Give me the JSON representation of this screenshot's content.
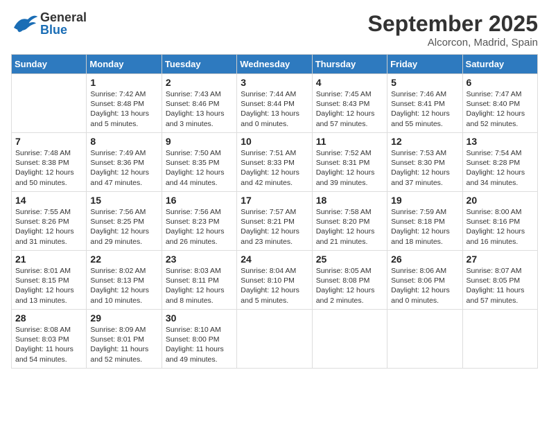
{
  "header": {
    "logo_general": "General",
    "logo_blue": "Blue",
    "month": "September 2025",
    "location": "Alcorcon, Madrid, Spain"
  },
  "days_of_week": [
    "Sunday",
    "Monday",
    "Tuesday",
    "Wednesday",
    "Thursday",
    "Friday",
    "Saturday"
  ],
  "weeks": [
    [
      {
        "day": "",
        "sunrise": "",
        "sunset": "",
        "daylight": ""
      },
      {
        "day": "1",
        "sunrise": "Sunrise: 7:42 AM",
        "sunset": "Sunset: 8:48 PM",
        "daylight": "Daylight: 13 hours and 5 minutes."
      },
      {
        "day": "2",
        "sunrise": "Sunrise: 7:43 AM",
        "sunset": "Sunset: 8:46 PM",
        "daylight": "Daylight: 13 hours and 3 minutes."
      },
      {
        "day": "3",
        "sunrise": "Sunrise: 7:44 AM",
        "sunset": "Sunset: 8:44 PM",
        "daylight": "Daylight: 13 hours and 0 minutes."
      },
      {
        "day": "4",
        "sunrise": "Sunrise: 7:45 AM",
        "sunset": "Sunset: 8:43 PM",
        "daylight": "Daylight: 12 hours and 57 minutes."
      },
      {
        "day": "5",
        "sunrise": "Sunrise: 7:46 AM",
        "sunset": "Sunset: 8:41 PM",
        "daylight": "Daylight: 12 hours and 55 minutes."
      },
      {
        "day": "6",
        "sunrise": "Sunrise: 7:47 AM",
        "sunset": "Sunset: 8:40 PM",
        "daylight": "Daylight: 12 hours and 52 minutes."
      }
    ],
    [
      {
        "day": "7",
        "sunrise": "Sunrise: 7:48 AM",
        "sunset": "Sunset: 8:38 PM",
        "daylight": "Daylight: 12 hours and 50 minutes."
      },
      {
        "day": "8",
        "sunrise": "Sunrise: 7:49 AM",
        "sunset": "Sunset: 8:36 PM",
        "daylight": "Daylight: 12 hours and 47 minutes."
      },
      {
        "day": "9",
        "sunrise": "Sunrise: 7:50 AM",
        "sunset": "Sunset: 8:35 PM",
        "daylight": "Daylight: 12 hours and 44 minutes."
      },
      {
        "day": "10",
        "sunrise": "Sunrise: 7:51 AM",
        "sunset": "Sunset: 8:33 PM",
        "daylight": "Daylight: 12 hours and 42 minutes."
      },
      {
        "day": "11",
        "sunrise": "Sunrise: 7:52 AM",
        "sunset": "Sunset: 8:31 PM",
        "daylight": "Daylight: 12 hours and 39 minutes."
      },
      {
        "day": "12",
        "sunrise": "Sunrise: 7:53 AM",
        "sunset": "Sunset: 8:30 PM",
        "daylight": "Daylight: 12 hours and 37 minutes."
      },
      {
        "day": "13",
        "sunrise": "Sunrise: 7:54 AM",
        "sunset": "Sunset: 8:28 PM",
        "daylight": "Daylight: 12 hours and 34 minutes."
      }
    ],
    [
      {
        "day": "14",
        "sunrise": "Sunrise: 7:55 AM",
        "sunset": "Sunset: 8:26 PM",
        "daylight": "Daylight: 12 hours and 31 minutes."
      },
      {
        "day": "15",
        "sunrise": "Sunrise: 7:56 AM",
        "sunset": "Sunset: 8:25 PM",
        "daylight": "Daylight: 12 hours and 29 minutes."
      },
      {
        "day": "16",
        "sunrise": "Sunrise: 7:56 AM",
        "sunset": "Sunset: 8:23 PM",
        "daylight": "Daylight: 12 hours and 26 minutes."
      },
      {
        "day": "17",
        "sunrise": "Sunrise: 7:57 AM",
        "sunset": "Sunset: 8:21 PM",
        "daylight": "Daylight: 12 hours and 23 minutes."
      },
      {
        "day": "18",
        "sunrise": "Sunrise: 7:58 AM",
        "sunset": "Sunset: 8:20 PM",
        "daylight": "Daylight: 12 hours and 21 minutes."
      },
      {
        "day": "19",
        "sunrise": "Sunrise: 7:59 AM",
        "sunset": "Sunset: 8:18 PM",
        "daylight": "Daylight: 12 hours and 18 minutes."
      },
      {
        "day": "20",
        "sunrise": "Sunrise: 8:00 AM",
        "sunset": "Sunset: 8:16 PM",
        "daylight": "Daylight: 12 hours and 16 minutes."
      }
    ],
    [
      {
        "day": "21",
        "sunrise": "Sunrise: 8:01 AM",
        "sunset": "Sunset: 8:15 PM",
        "daylight": "Daylight: 12 hours and 13 minutes."
      },
      {
        "day": "22",
        "sunrise": "Sunrise: 8:02 AM",
        "sunset": "Sunset: 8:13 PM",
        "daylight": "Daylight: 12 hours and 10 minutes."
      },
      {
        "day": "23",
        "sunrise": "Sunrise: 8:03 AM",
        "sunset": "Sunset: 8:11 PM",
        "daylight": "Daylight: 12 hours and 8 minutes."
      },
      {
        "day": "24",
        "sunrise": "Sunrise: 8:04 AM",
        "sunset": "Sunset: 8:10 PM",
        "daylight": "Daylight: 12 hours and 5 minutes."
      },
      {
        "day": "25",
        "sunrise": "Sunrise: 8:05 AM",
        "sunset": "Sunset: 8:08 PM",
        "daylight": "Daylight: 12 hours and 2 minutes."
      },
      {
        "day": "26",
        "sunrise": "Sunrise: 8:06 AM",
        "sunset": "Sunset: 8:06 PM",
        "daylight": "Daylight: 12 hours and 0 minutes."
      },
      {
        "day": "27",
        "sunrise": "Sunrise: 8:07 AM",
        "sunset": "Sunset: 8:05 PM",
        "daylight": "Daylight: 11 hours and 57 minutes."
      }
    ],
    [
      {
        "day": "28",
        "sunrise": "Sunrise: 8:08 AM",
        "sunset": "Sunset: 8:03 PM",
        "daylight": "Daylight: 11 hours and 54 minutes."
      },
      {
        "day": "29",
        "sunrise": "Sunrise: 8:09 AM",
        "sunset": "Sunset: 8:01 PM",
        "daylight": "Daylight: 11 hours and 52 minutes."
      },
      {
        "day": "30",
        "sunrise": "Sunrise: 8:10 AM",
        "sunset": "Sunset: 8:00 PM",
        "daylight": "Daylight: 11 hours and 49 minutes."
      },
      {
        "day": "",
        "sunrise": "",
        "sunset": "",
        "daylight": ""
      },
      {
        "day": "",
        "sunrise": "",
        "sunset": "",
        "daylight": ""
      },
      {
        "day": "",
        "sunrise": "",
        "sunset": "",
        "daylight": ""
      },
      {
        "day": "",
        "sunrise": "",
        "sunset": "",
        "daylight": ""
      }
    ]
  ]
}
